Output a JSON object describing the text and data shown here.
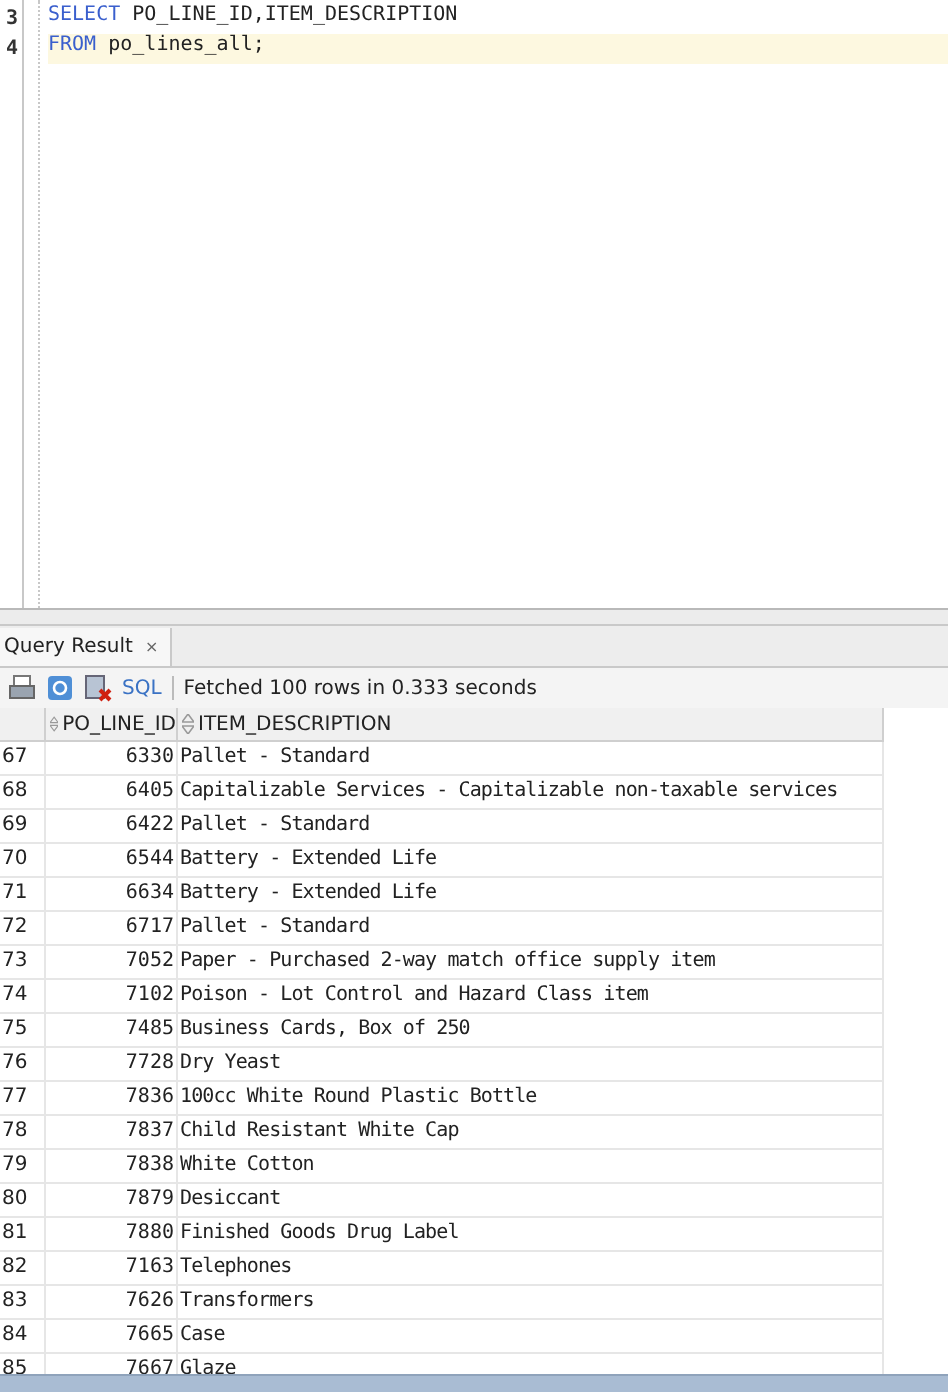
{
  "editor": {
    "lines": [
      {
        "number": "3",
        "current": false,
        "tokens": [
          {
            "text": "SELECT",
            "kind": "keyword"
          },
          {
            "text": " PO_LINE_ID,ITEM_DESCRIPTION",
            "kind": "plain"
          }
        ]
      },
      {
        "number": "4",
        "current": true,
        "tokens": [
          {
            "text": "FROM",
            "kind": "keyword"
          },
          {
            "text": " po_lines_all;",
            "kind": "plain"
          }
        ]
      }
    ]
  },
  "tabs": [
    {
      "label": "Query Result",
      "close": "×",
      "selected": true
    }
  ],
  "toolbar": {
    "sql_link": "SQL",
    "status": "Fetched 100 rows in 0.333 seconds"
  },
  "table": {
    "columns": [
      "PO_LINE_ID",
      "ITEM_DESCRIPTION"
    ],
    "rows": [
      {
        "row": "67",
        "id": "6330",
        "desc": "Pallet - Standard"
      },
      {
        "row": "68",
        "id": "6405",
        "desc": "Capitalizable Services - Capitalizable non-taxable services"
      },
      {
        "row": "69",
        "id": "6422",
        "desc": "Pallet - Standard"
      },
      {
        "row": "70",
        "id": "6544",
        "desc": "Battery - Extended Life"
      },
      {
        "row": "71",
        "id": "6634",
        "desc": "Battery - Extended Life"
      },
      {
        "row": "72",
        "id": "6717",
        "desc": "Pallet - Standard"
      },
      {
        "row": "73",
        "id": "7052",
        "desc": "Paper - Purchased 2-way match office supply item"
      },
      {
        "row": "74",
        "id": "7102",
        "desc": "Poison - Lot Control and Hazard Class item"
      },
      {
        "row": "75",
        "id": "7485",
        "desc": "Business Cards, Box of 250"
      },
      {
        "row": "76",
        "id": "7728",
        "desc": "Dry Yeast"
      },
      {
        "row": "77",
        "id": "7836",
        "desc": "100cc White Round Plastic Bottle"
      },
      {
        "row": "78",
        "id": "7837",
        "desc": "Child Resistant White Cap"
      },
      {
        "row": "79",
        "id": "7838",
        "desc": "White Cotton"
      },
      {
        "row": "80",
        "id": "7879",
        "desc": "Desiccant"
      },
      {
        "row": "81",
        "id": "7880",
        "desc": "Finished Goods Drug Label"
      },
      {
        "row": "82",
        "id": "7163",
        "desc": "Telephones"
      },
      {
        "row": "83",
        "id": "7626",
        "desc": "Transformers"
      },
      {
        "row": "84",
        "id": "7665",
        "desc": "Case"
      },
      {
        "row": "85",
        "id": "7667",
        "desc": "Glaze"
      }
    ]
  }
}
